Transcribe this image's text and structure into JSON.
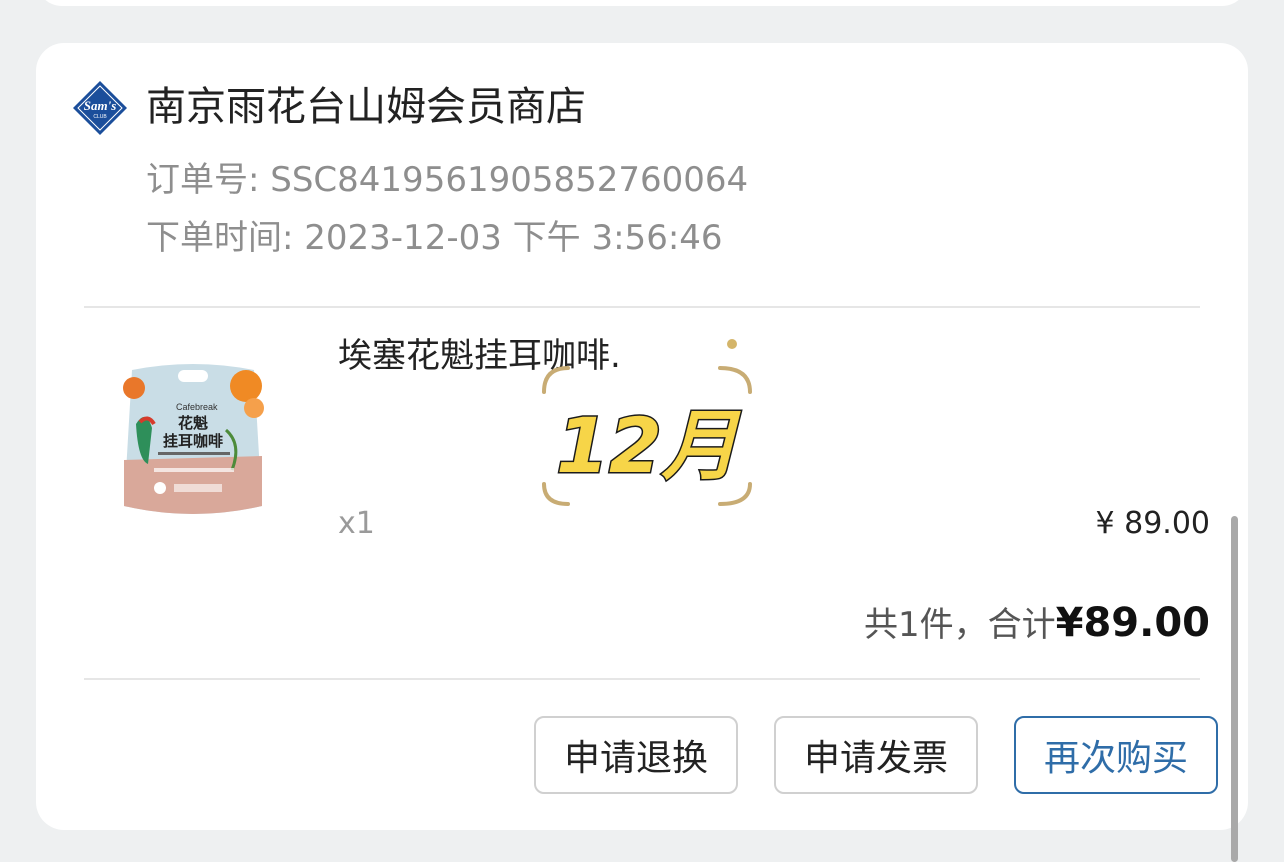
{
  "store": {
    "logo_text": "Sam's",
    "logo_sub": "CLUB",
    "name": "南京雨花台山姆会员商店"
  },
  "order": {
    "number_text": "订单号: SSC8419561905852760064",
    "time_text": "下单时间: 2023-12-03 下午 3:56:46"
  },
  "product": {
    "name": "埃塞花魁挂耳咖啡.",
    "quantity": "x1",
    "price": "¥ 89.00",
    "package_brand": "Cafebreak",
    "package_title_1": "花魁",
    "package_title_2": "挂耳咖啡"
  },
  "sticker": {
    "text": "12月"
  },
  "summary": {
    "count_text": "共1件，合计",
    "total": "¥89.00"
  },
  "actions": {
    "return_label": "申请退换",
    "invoice_label": "申请发票",
    "rebuy_label": "再次购买"
  },
  "colors": {
    "background": "#eef0f1",
    "card": "#ffffff",
    "accent": "#2f6da8",
    "muted_text": "#8e8e8e",
    "sticker_fill": "#f7d548"
  }
}
